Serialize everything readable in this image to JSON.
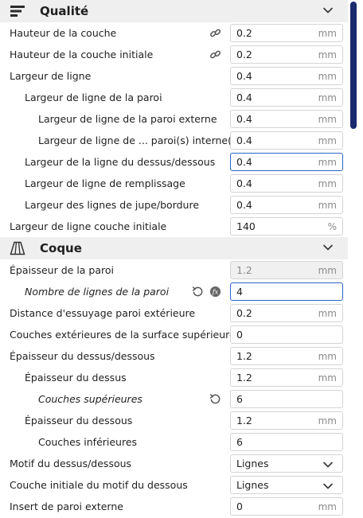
{
  "sections": [
    {
      "title": "Qualité",
      "rows": [
        {
          "label": "Hauteur de la couche",
          "value": "0.2",
          "unit": "mm",
          "indent": 0,
          "link": true
        },
        {
          "label": "Hauteur de la couche initiale",
          "value": "0.2",
          "unit": "mm",
          "indent": 0,
          "link": true
        },
        {
          "label": "Largeur de ligne",
          "value": "0.4",
          "unit": "mm",
          "indent": 0
        },
        {
          "label": "Largeur de ligne de la paroi",
          "value": "0.4",
          "unit": "mm",
          "indent": 1
        },
        {
          "label": "Largeur de ligne de la paroi externe",
          "value": "0.4",
          "unit": "mm",
          "indent": 2
        },
        {
          "label": "Largeur de ligne de ... paroi(s) interne(s)",
          "value": "0.4",
          "unit": "mm",
          "indent": 2
        },
        {
          "label": "Largeur de la ligne du dessus/dessous",
          "value": "0.4",
          "unit": "mm",
          "indent": 1,
          "focused": true
        },
        {
          "label": "Largeur de ligne de remplissage",
          "value": "0.4",
          "unit": "mm",
          "indent": 1
        },
        {
          "label": "Largeur des lignes de jupe/bordure",
          "value": "0.4",
          "unit": "mm",
          "indent": 1
        },
        {
          "label": "Largeur de ligne couche initiale",
          "value": "140",
          "unit": "%",
          "indent": 0
        }
      ]
    },
    {
      "title": "Coque",
      "rows": [
        {
          "label": "Épaisseur de la paroi",
          "value": "1.2",
          "unit": "mm",
          "indent": 0,
          "disabled": true
        },
        {
          "label": "Nombre de lignes de la paroi",
          "value": "4",
          "unit": "",
          "indent": 1,
          "italic": true,
          "reset": true,
          "fx": true,
          "focused": true
        },
        {
          "label": "Distance d'essuyage paroi extérieure",
          "value": "0.2",
          "unit": "mm",
          "indent": 0
        },
        {
          "label": "Couches extérieures de la surface supérieure",
          "value": "0",
          "unit": "",
          "indent": 0
        },
        {
          "label": "Épaisseur du dessus/dessous",
          "value": "1.2",
          "unit": "mm",
          "indent": 0
        },
        {
          "label": "Épaisseur du dessus",
          "value": "1.2",
          "unit": "mm",
          "indent": 1
        },
        {
          "label": "Couches supérieures",
          "value": "6",
          "unit": "",
          "indent": 2,
          "italic": true,
          "reset": true
        },
        {
          "label": "Épaisseur du dessous",
          "value": "1.2",
          "unit": "mm",
          "indent": 1
        },
        {
          "label": "Couches inférieures",
          "value": "6",
          "unit": "",
          "indent": 2
        },
        {
          "label": "Motif du dessus/dessous",
          "value": "Lignes",
          "unit": "",
          "indent": 0,
          "dropdown": true
        },
        {
          "label": "Couche initiale du motif du dessous",
          "value": "Lignes",
          "unit": "",
          "indent": 0,
          "dropdown": true
        },
        {
          "label": "Insert de paroi externe",
          "value": "0",
          "unit": "mm",
          "indent": 0
        }
      ]
    }
  ],
  "icons": {
    "quality": "quality-lines-icon",
    "shell": "shell-trapezoid-icon",
    "collapse": "chevron-down-icon",
    "link": "link-icon",
    "reset": "reset-arrow-icon",
    "formula": "formula-fx-icon",
    "dropdown": "chevron-down-icon"
  },
  "colors": {
    "accent": "#2a66c7",
    "scrollbar": "#1a2a6c",
    "header_bg": "#efefef"
  }
}
